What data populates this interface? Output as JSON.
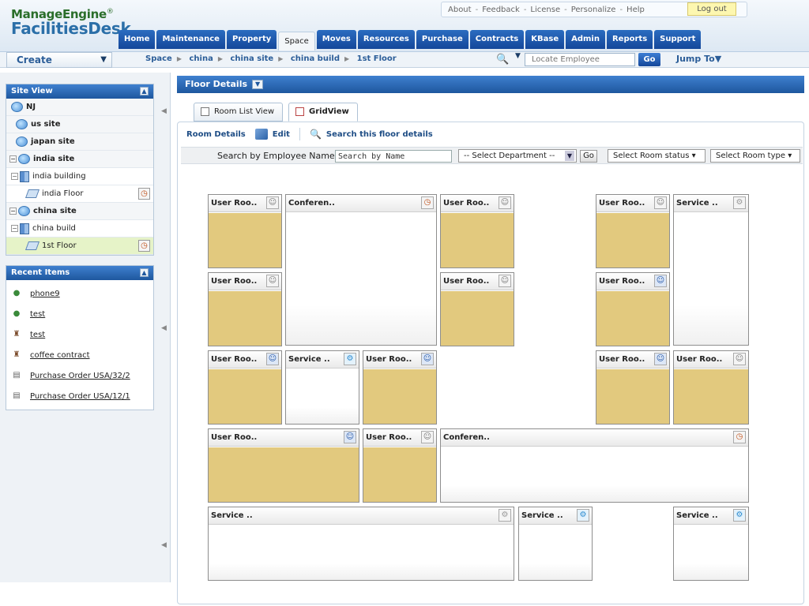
{
  "brand": {
    "top": "ManageEngine",
    "top_suffix": "®",
    "bottom": "FacilitiesDesk"
  },
  "toplinks": [
    "About",
    "Feedback",
    "License",
    "Personalize",
    "Help"
  ],
  "logout": "Log out",
  "tabs": [
    "Home",
    "Maintenance",
    "Property",
    "Space",
    "Moves",
    "Resources",
    "Purchase",
    "Contracts",
    "KBase",
    "Admin",
    "Reports",
    "Support"
  ],
  "active_tab": "Space",
  "create_label": "Create",
  "breadcrumb": [
    "Space",
    "china",
    "china site",
    "china build",
    "1st Floor"
  ],
  "locate": {
    "placeholder": "Locate Employee",
    "go": "Go"
  },
  "jump_to": "Jump To",
  "site_view": {
    "title": "Site View",
    "items": [
      {
        "label": "NJ",
        "type": "site"
      },
      {
        "label": "us site",
        "type": "site"
      },
      {
        "label": "japan site",
        "type": "site"
      },
      {
        "label": "india site",
        "type": "site-open"
      },
      {
        "label": "india building",
        "type": "building"
      },
      {
        "label": "india Floor",
        "type": "floor"
      },
      {
        "label": "china site",
        "type": "site-open"
      },
      {
        "label": "china build",
        "type": "building"
      },
      {
        "label": "1st Floor",
        "type": "floor",
        "selected": true
      }
    ]
  },
  "recent_items": {
    "title": "Recent Items",
    "items": [
      "phone9",
      "test",
      "test",
      "coffee contract",
      "Purchase Order USA/32/2",
      "Purchase Order USA/12/1"
    ]
  },
  "floor_details": {
    "title": "Floor Details",
    "subtabs": [
      "Room List View",
      "GridView"
    ],
    "actions": {
      "room_details": "Room Details",
      "edit": "Edit",
      "search": "Search this floor details"
    },
    "filter": {
      "label": "Search by Employee Name",
      "search_value": "Search by Name",
      "department": "-- Select Department --",
      "go": "Go",
      "room_status": "Select Room status",
      "room_type": "Select Room type"
    }
  },
  "rooms": [
    {
      "label": "User Roo..",
      "kind": "user",
      "icon": "user"
    },
    {
      "label": "Conferen..",
      "kind": "conf",
      "icon": "clock"
    },
    {
      "label": "User Roo..",
      "kind": "user",
      "icon": "user"
    },
    {
      "label": "User Roo..",
      "kind": "user",
      "icon": "user"
    },
    {
      "label": "Service ..",
      "kind": "svc",
      "icon": "svc"
    },
    {
      "label": "User Roo..",
      "kind": "user",
      "icon": "user"
    },
    {
      "label": "User Roo..",
      "kind": "user",
      "icon": "user"
    },
    {
      "label": "User Roo..",
      "kind": "user",
      "icon": "user-blue"
    },
    {
      "label": "User Roo..",
      "kind": "user",
      "icon": "user-blue"
    },
    {
      "label": "Service ..",
      "kind": "svc",
      "icon": "svc-blue"
    },
    {
      "label": "User Roo..",
      "kind": "user",
      "icon": "user-blue"
    },
    {
      "label": "User Roo..",
      "kind": "user",
      "icon": "user-blue"
    },
    {
      "label": "User Roo..",
      "kind": "user",
      "icon": "user"
    },
    {
      "label": "User Roo..",
      "kind": "user",
      "icon": "user-blue"
    },
    {
      "label": "User Roo..",
      "kind": "user",
      "icon": "user"
    },
    {
      "label": "Conferen..",
      "kind": "conf",
      "icon": "clock"
    },
    {
      "label": "Service ..",
      "kind": "svc",
      "icon": "svc"
    },
    {
      "label": "Service ..",
      "kind": "svc",
      "icon": "svc-blue"
    },
    {
      "label": "Service ..",
      "kind": "svc",
      "icon": "svc-blue"
    }
  ]
}
